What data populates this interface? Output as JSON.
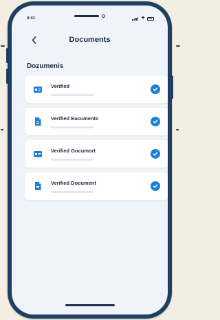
{
  "status_bar": {
    "time": "0:41"
  },
  "nav": {
    "back_icon": "chevron-left-icon",
    "title": "Documents"
  },
  "section": {
    "title": "Dozumenis"
  },
  "documents": [
    {
      "label": "Verified",
      "icon": "id-card-icon",
      "verified": true
    },
    {
      "label": "Verified Eacuments",
      "icon": "document-icon",
      "verified": true
    },
    {
      "label": "Verified Gocumort",
      "icon": "id-card-icon",
      "verified": true
    },
    {
      "label": "Verified Document",
      "icon": "document-icon",
      "verified": true
    }
  ],
  "colors": {
    "accent": "#1f7fd6",
    "frame": "#1f3f63",
    "screen_bg": "#eef4fa",
    "page_bg": "#f3eee2"
  }
}
